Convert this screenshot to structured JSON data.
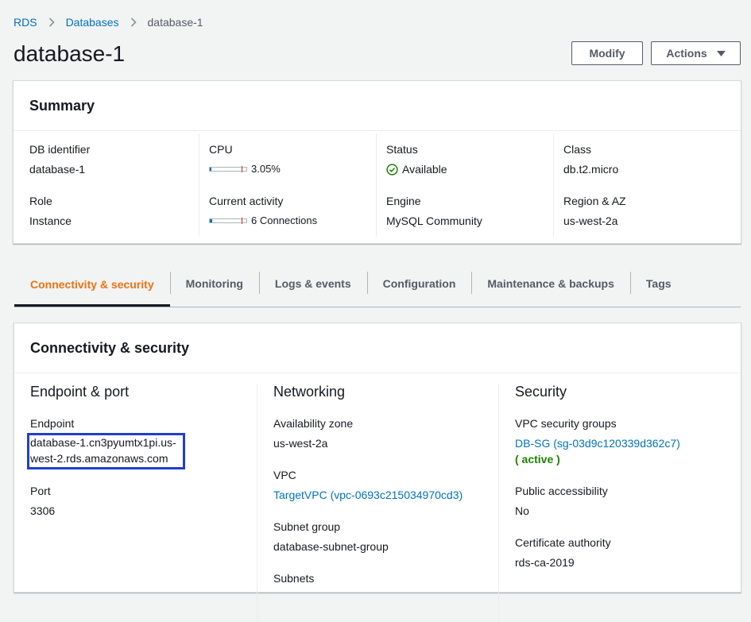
{
  "breadcrumb": {
    "root": "RDS",
    "section": "Databases",
    "current": "database-1"
  },
  "page": {
    "title": "database-1"
  },
  "actions": {
    "modify_label": "Modify",
    "actions_label": "Actions"
  },
  "summary": {
    "heading": "Summary",
    "db_identifier": {
      "label": "DB identifier",
      "value": "database-1"
    },
    "cpu": {
      "label": "CPU",
      "value": "3.05%",
      "fraction": 0.0305
    },
    "status": {
      "label": "Status",
      "value": "Available",
      "color": "#1d8102"
    },
    "class": {
      "label": "Class",
      "value": "db.t2.micro"
    },
    "role": {
      "label": "Role",
      "value": "Instance"
    },
    "current_activity": {
      "label": "Current activity",
      "value": "6 Connections"
    },
    "engine": {
      "label": "Engine",
      "value": "MySQL Community"
    },
    "region_az": {
      "label": "Region & AZ",
      "value": "us-west-2a"
    }
  },
  "tabs": [
    {
      "label": "Connectivity & security",
      "active": true
    },
    {
      "label": "Monitoring"
    },
    {
      "label": "Logs & events"
    },
    {
      "label": "Configuration"
    },
    {
      "label": "Maintenance & backups"
    },
    {
      "label": "Tags"
    }
  ],
  "connectivity": {
    "heading": "Connectivity & security",
    "endpoint_port": {
      "title": "Endpoint & port",
      "endpoint_label": "Endpoint",
      "endpoint_value": "database-1.cn3pyumtx1pi.us-west-2.rds.amazonaws.com",
      "port_label": "Port",
      "port_value": "3306"
    },
    "networking": {
      "title": "Networking",
      "az_label": "Availability zone",
      "az_value": "us-west-2a",
      "vpc_label": "VPC",
      "vpc_value": "TargetVPC (vpc-0693c215034970cd3)",
      "subnet_group_label": "Subnet group",
      "subnet_group_value": "database-subnet-group",
      "subnets_label": "Subnets"
    },
    "security": {
      "title": "Security",
      "sg_label": "VPC security groups",
      "sg_value": "DB-SG (sg-03d9c120339d362c7)",
      "sg_status": "( active )",
      "public_label": "Public accessibility",
      "public_value": "No",
      "ca_label": "Certificate authority",
      "ca_value": "rds-ca-2019"
    }
  },
  "colors": {
    "accent": "#ec7211",
    "link": "#0073bb",
    "highlight_box": "#1f3fcc"
  }
}
